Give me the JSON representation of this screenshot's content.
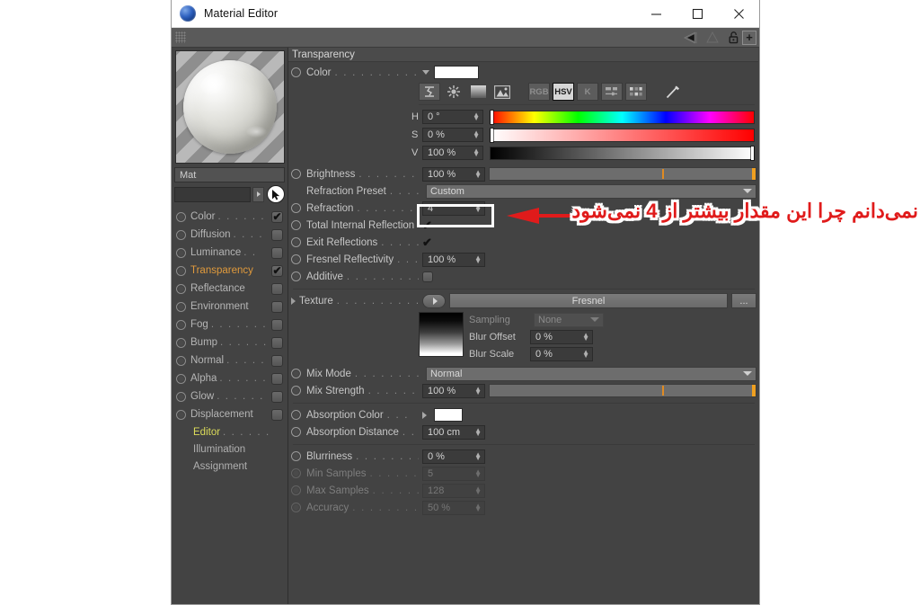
{
  "window": {
    "title": "Material Editor",
    "icon": "app-sphere-icon",
    "minimize_label": "—",
    "maximize_label": "□",
    "close_label": "✕"
  },
  "toolbar": {
    "grip": "drag-grip",
    "prev_label": "◀",
    "next_label": "▷",
    "up_label": "△",
    "lock_label": "lock-icon",
    "add_label": "+"
  },
  "left": {
    "preview_name": "material-preview",
    "material_name": "Mat",
    "search_value": "",
    "search_arrow": "▸",
    "cursor_icon": "pointer-icon",
    "channels": [
      {
        "label": "Color",
        "dots": ". . . . . . .",
        "checked": true,
        "active": false
      },
      {
        "label": "Diffusion",
        "dots": ". . . .",
        "checked": false,
        "active": false
      },
      {
        "label": "Luminance",
        "dots": ". .",
        "checked": false,
        "active": false
      },
      {
        "label": "Transparency",
        "dots": "",
        "checked": true,
        "active": true
      },
      {
        "label": "Reflectance",
        "dots": "",
        "checked": false,
        "active": false
      },
      {
        "label": "Environment",
        "dots": "",
        "checked": false,
        "active": false
      },
      {
        "label": "Fog",
        "dots": ". . . . . . . .",
        "checked": false,
        "active": false
      },
      {
        "label": "Bump",
        "dots": ". . . . . .",
        "checked": false,
        "active": false
      },
      {
        "label": "Normal",
        "dots": ". . . . .",
        "checked": false,
        "active": false
      },
      {
        "label": "Alpha",
        "dots": ". . . . . .",
        "checked": false,
        "active": false
      },
      {
        "label": "Glow",
        "dots": ". . . . . . .",
        "checked": false,
        "active": false
      },
      {
        "label": "Displacement",
        "dots": "",
        "checked": false,
        "active": false
      }
    ],
    "subitems": [
      {
        "label": "Editor",
        "dots": ". . . . . .",
        "selected": true
      },
      {
        "label": "Illumination",
        "dots": "",
        "selected": false
      },
      {
        "label": "Assignment",
        "dots": "",
        "selected": false
      }
    ],
    "checkmark": "✔"
  },
  "panel": {
    "section_title": "Transparency",
    "color": {
      "label": "Color",
      "dots": ". . . . . . . . . . . .",
      "swatch_hex": "#ffffff",
      "mode_buttons": [
        {
          "name": "range-icon",
          "text": ""
        },
        {
          "name": "colorwheel-icon",
          "text": ""
        },
        {
          "name": "gradient-icon",
          "text": ""
        },
        {
          "name": "image-icon",
          "text": ""
        },
        {
          "name": "rgb-button",
          "text": "RGB"
        },
        {
          "name": "hsv-button",
          "text": "HSV"
        },
        {
          "name": "kelvin-button",
          "text": "K"
        },
        {
          "name": "sliders-icon",
          "text": ""
        },
        {
          "name": "swatches-icon",
          "text": ""
        },
        {
          "name": "eyedropper-icon",
          "text": ""
        }
      ],
      "active_mode": "HSV",
      "hsv": [
        {
          "letter": "H",
          "value": "0 °",
          "knob_pct": 0
        },
        {
          "letter": "S",
          "value": "0 %",
          "knob_pct": 0
        },
        {
          "letter": "V",
          "value": "100 %",
          "knob_pct": 100
        }
      ]
    },
    "brightness": {
      "label": "Brightness",
      "dots": ". . . . . . . . . .",
      "value": "100 %",
      "slider_mark_pct": 65
    },
    "refraction_preset": {
      "label": "Refraction Preset",
      "dots": ". . . . . .",
      "value": "Custom"
    },
    "refraction": {
      "label": "Refraction",
      "dots": ". . . . . . . . . .",
      "value": "4"
    },
    "total_internal_refl": {
      "label": "Total Internal Reflection",
      "dots": "",
      "checked": true
    },
    "exit_reflections": {
      "label": "Exit Reflections",
      "dots": ". . . . . . .",
      "checked": true
    },
    "fresnel_reflectivity": {
      "label": "Fresnel Reflectivity",
      "dots": ". . . .",
      "value": "100 %"
    },
    "additive": {
      "label": "Additive",
      "dots": ". . . . . . . . . . .",
      "checked": false
    },
    "texture": {
      "label": "Texture",
      "dots": ". . . . . . . . . . . .",
      "name": "Fresnel",
      "browse_label": "...",
      "sampling_label": "Sampling",
      "sampling_value": "None",
      "blur_offset_label": "Blur Offset",
      "blur_offset_value": "0 %",
      "blur_scale_label": "Blur Scale",
      "blur_scale_value": "0 %"
    },
    "mix_mode": {
      "label": "Mix Mode",
      "dots": ". . . . . . . . . .",
      "value": "Normal"
    },
    "mix_strength": {
      "label": "Mix Strength",
      "dots": ". . . . . . . . .",
      "value": "100 %",
      "slider_mark_pct": 65
    },
    "absorption_color": {
      "label": "Absorption Color",
      "dots": ". . .",
      "swatch_hex": "#ffffff"
    },
    "absorption_distance": {
      "label": "Absorption Distance",
      "dots": ". . .",
      "value": "100 cm"
    },
    "blurriness": {
      "label": "Blurriness",
      "dots": ". . . . . . . . . . .",
      "value": "0 %",
      "disabled": false
    },
    "min_samples": {
      "label": "Min Samples",
      "dots": ". . . . . . . . .",
      "value": "5",
      "disabled": true
    },
    "max_samples": {
      "label": "Max Samples",
      "dots": ". . . . . . . . .",
      "value": "128",
      "disabled": true
    },
    "accuracy": {
      "label": "Accuracy",
      "dots": ". . . . . . . . . . . .",
      "value": "50 %",
      "disabled": true
    },
    "checkmark": "✔"
  },
  "annotation": {
    "text": "نمی‌دانم چرا این مقدار بیشتر از 4 نمی‌شود",
    "color": "#e01b1b",
    "arrow": "left-arrow"
  }
}
